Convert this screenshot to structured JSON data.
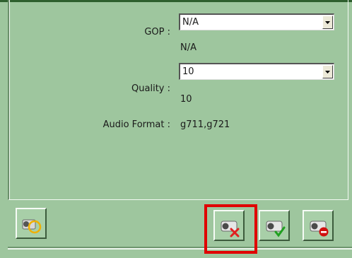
{
  "form": {
    "gop": {
      "label": "GOP :",
      "selected": "N/A",
      "current": "N/A"
    },
    "quality": {
      "label": "Quality :",
      "selected": "10",
      "current": "10"
    },
    "audio_format": {
      "label": "Audio Format :",
      "value": "g711,g721"
    }
  },
  "toolbar": {
    "left_button_icon": "camera-settings-icon",
    "cancel_button_icon": "camera-cancel-icon",
    "apply_button_icon": "camera-apply-icon",
    "delete_button_icon": "camera-delete-icon"
  },
  "colors": {
    "panel_background": "#9ec69e",
    "highlight": "#e00000",
    "cancel_mark": "#e02020",
    "apply_mark": "#20a020",
    "delete_mark": "#d01010",
    "settings_ring": "#f0b000"
  }
}
